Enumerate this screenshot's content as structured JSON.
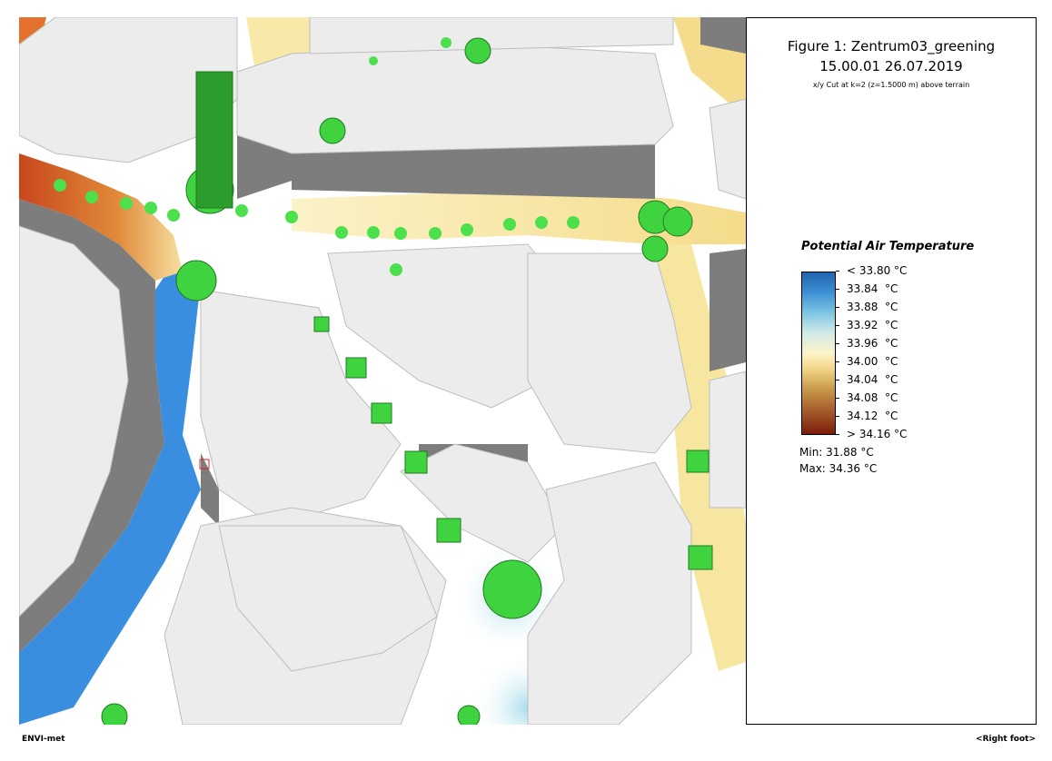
{
  "figure": {
    "title_line1": "Figure 1: Zentrum03_greening",
    "title_line2": "15.00.01 26.07.2019",
    "subtitle": "x/y Cut at k=2 (z=1.5000 m) above terrain"
  },
  "legend": {
    "title": "Potential Air Temperature",
    "ticks": [
      "< 33.80 °C",
      "33.84  °C",
      "33.88  °C",
      "33.92  °C",
      "33.96  °C",
      "34.00  °C",
      "34.04  °C",
      "34.08  °C",
      "34.12  °C",
      "> 34.16 °C"
    ],
    "colors": [
      "#1f63ad",
      "#7dc6e2",
      "#fdf4c8",
      "#c99a4a",
      "#7b1c0a"
    ],
    "min_label": "Min: 31.88 °C",
    "max_label": "Max: 34.36 °C"
  },
  "footer": {
    "left": "ENVI-met",
    "right": "<Right foot>"
  }
}
